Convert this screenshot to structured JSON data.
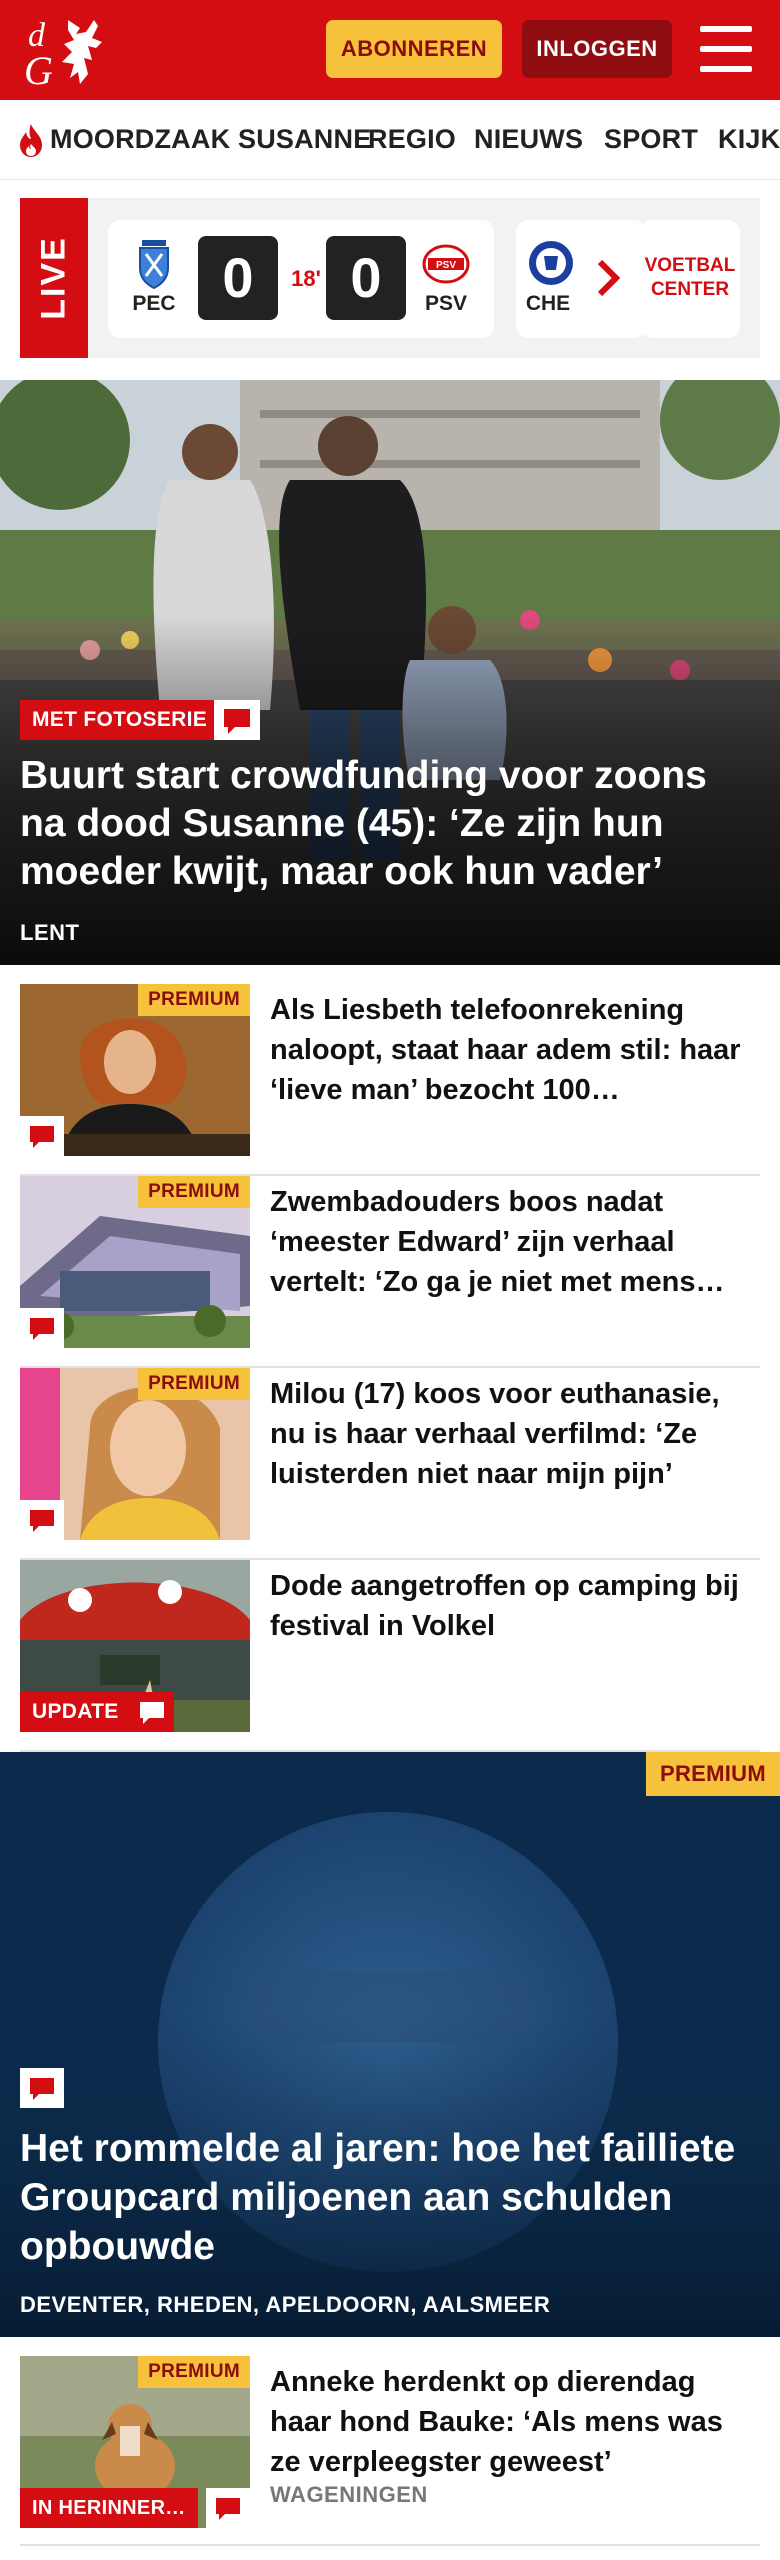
{
  "header": {
    "logo_text": "dG",
    "subscribe_label": "ABONNEREN",
    "login_label": "INLOGGEN",
    "brand_color": "#d40d12"
  },
  "nav": {
    "items": [
      {
        "label": "MOORDZAAK SUSANNE",
        "icon": "flame-icon"
      },
      {
        "label": "REGIO"
      },
      {
        "label": "NIEUWS"
      },
      {
        "label": "SPORT"
      },
      {
        "label": "KIJK"
      }
    ]
  },
  "live": {
    "label": "LIVE",
    "match": {
      "home": "PEC",
      "away": "PSV",
      "home_score": "0",
      "away_score": "0",
      "minute": "18'"
    },
    "next_match_home": "CHE",
    "voetbal_center": "VOETBAL CENTER"
  },
  "hero": {
    "badge": "MET FOTOSERIE",
    "title": "Buurt start crowdfunding voor zoons na dood Susanne (45): ‘Ze zijn hun moeder kwijt, maar ook hun vader’",
    "location": "LENT"
  },
  "articles": [
    {
      "premium": "PREMIUM",
      "title": "Als Liesbeth telefoonrekening naloopt, staat haar adem stil: haar ‘lieve man’ bezocht 100…",
      "location": ""
    },
    {
      "premium": "PREMIUM",
      "title": "Zwembadouders boos nadat ‘meester Edward’ zijn verhaal vertelt: ‘Zo ga je niet met mens…",
      "location": ""
    },
    {
      "premium": "PREMIUM",
      "title": "Milou (17) koos voor euthanasie, nu is haar verhaal verfilmd: ‘Ze luisterden niet naar mijn pijn’",
      "location": ""
    },
    {
      "badge": "UPDATE",
      "title": "Dode aangetroffen op camping bij festival in Volkel",
      "location": ""
    }
  ],
  "featured": {
    "premium": "PREMIUM",
    "title": "Het rommelde al jaren: hoe het failliete Groupcard miljoenen aan schulden opbouwde",
    "location": "DEVENTER, RHEDEN, APELDOORN, AALSMEER"
  },
  "article_after": {
    "premium": "PREMIUM",
    "badge": "IN HERINNER…",
    "title": "Anneke herdenkt op dierendag haar hond Bauke: ‘Als mens was ze verpleegster geweest’",
    "location": "WAGENINGEN"
  }
}
